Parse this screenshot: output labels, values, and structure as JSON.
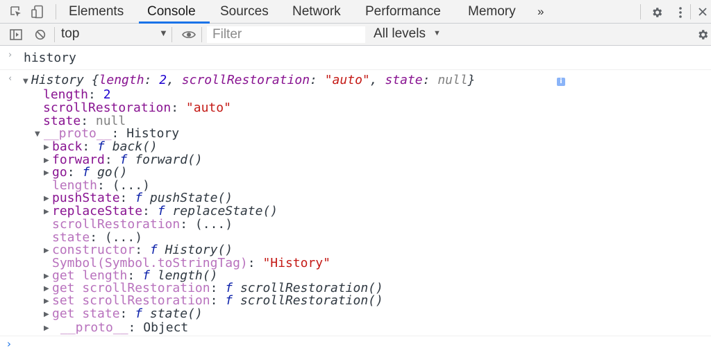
{
  "tabs": {
    "items": [
      "Elements",
      "Console",
      "Sources",
      "Network",
      "Performance",
      "Memory"
    ],
    "more": "»",
    "active": "Console"
  },
  "toolbar": {
    "context": "top",
    "filter_placeholder": "Filter",
    "levels": "All levels"
  },
  "console": {
    "input_command": "history",
    "summary": {
      "type": "History",
      "open": " {",
      "k_length": "length",
      "v_length": "2",
      "k_scroll": "scrollRestoration",
      "v_scroll": "\"auto\"",
      "k_state": "state",
      "v_state": "null",
      "close": "}"
    },
    "props": [
      {
        "key": "length",
        "value": "2"
      },
      {
        "key": "scrollRestoration",
        "value": "\"auto\""
      },
      {
        "key": "state",
        "value": "null"
      }
    ],
    "proto_label": "__proto__",
    "proto_value": "History",
    "proto_members": [
      {
        "key": "back",
        "fn": "back()"
      },
      {
        "key": "forward",
        "fn": "forward()"
      },
      {
        "key": "go",
        "fn": "go()"
      },
      {
        "key": "length",
        "getter": "(...)"
      },
      {
        "key": "pushState",
        "fn": "pushState()"
      },
      {
        "key": "replaceState",
        "fn": "replaceState()"
      },
      {
        "key": "scrollRestoration",
        "getter": "(...)"
      },
      {
        "key": "state",
        "getter": "(...)"
      },
      {
        "key": "constructor",
        "fn": "History()"
      },
      {
        "key": "Symbol(Symbol.toStringTag)",
        "value": "\"History\""
      },
      {
        "key": "get length",
        "fn": "length()"
      },
      {
        "key": "get scrollRestoration",
        "fn": "scrollRestoration()"
      },
      {
        "key": "set scrollRestoration",
        "fn": "scrollRestoration()"
      },
      {
        "key": "get state",
        "fn": "state()"
      }
    ],
    "proto2_label": "__proto__",
    "proto2_value": "Object",
    "fn_marker": "f",
    "info_badge": "i"
  },
  "colors": {
    "accent": "#1a73e8",
    "key": "#881391",
    "proto_key": "#b871bd",
    "number": "#1c00cf",
    "string": "#c41a16",
    "null": "#808080"
  },
  "icons": [
    "inspect-element-icon",
    "device-toolbar-icon",
    "more-tabs-icon",
    "settings-gear-icon",
    "kebab-menu-icon",
    "sidebar-toggle-icon",
    "clear-console-icon",
    "eye-icon"
  ]
}
